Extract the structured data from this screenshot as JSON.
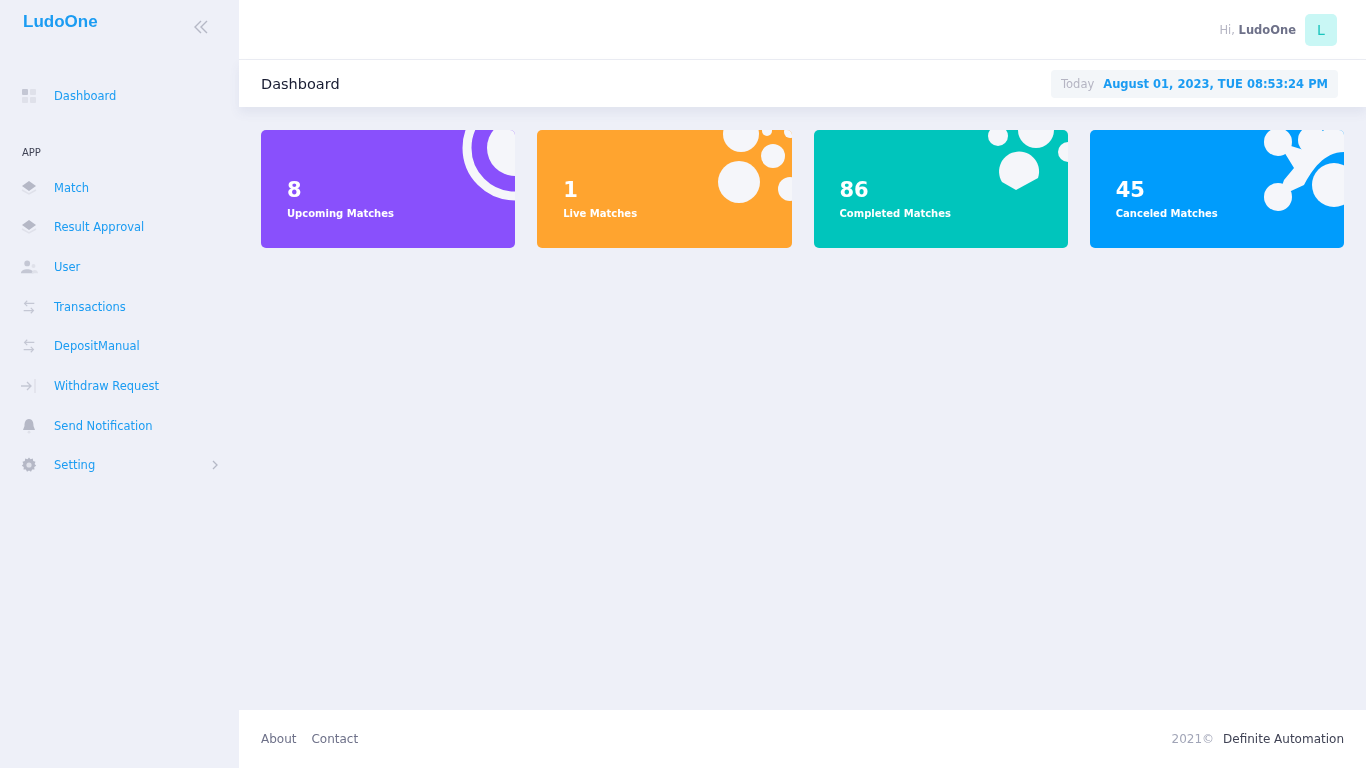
{
  "sidebar": {
    "logo": "LudoOne",
    "top_items": [
      {
        "label": "Dashboard",
        "has_submenu": false
      }
    ],
    "section": "APP",
    "items": [
      {
        "label": "Match",
        "has_submenu": false
      },
      {
        "label": "Result Approval",
        "has_submenu": false
      },
      {
        "label": "User",
        "has_submenu": false
      },
      {
        "label": "Transactions",
        "has_submenu": false
      },
      {
        "label": "DepositManual",
        "has_submenu": false
      },
      {
        "label": "Withdraw Request",
        "has_submenu": false
      },
      {
        "label": "Send Notification",
        "has_submenu": false
      },
      {
        "label": "Setting",
        "has_submenu": true
      }
    ]
  },
  "header": {
    "greeting": "Hi,",
    "user_name": "LudoOne",
    "avatar": "L"
  },
  "subheader": {
    "title": "Dashboard",
    "date_label": "Today",
    "date": "August 01, 2023, TUE 08:53:24 PM"
  },
  "cards": [
    {
      "value": "8",
      "label": "Upcoming Matches",
      "color": "#8950fc",
      "kind": "rings"
    },
    {
      "value": "1",
      "label": "Live Matches",
      "color": "#ffa42f",
      "kind": "bubbles"
    },
    {
      "value": "86",
      "label": "Completed Matches",
      "color": "#00c5bc",
      "kind": "drops"
    },
    {
      "value": "45",
      "label": "Canceled Matches",
      "color": "#009cfc",
      "kind": "blobs"
    }
  ],
  "footer": {
    "links": [
      "About",
      "Contact"
    ],
    "year": "2021©",
    "company": "Definite Automation"
  }
}
